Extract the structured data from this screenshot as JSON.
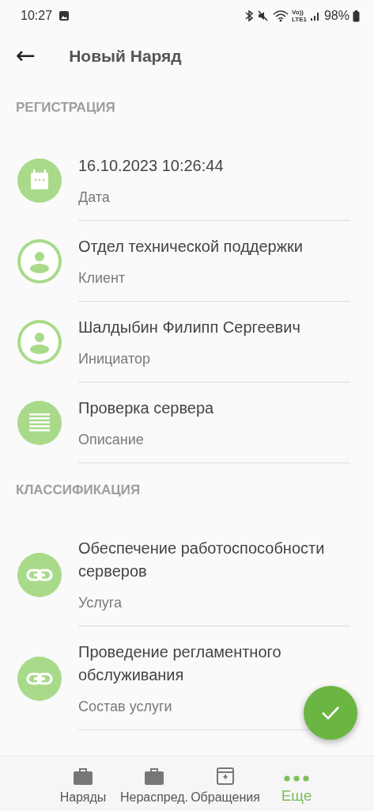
{
  "status_bar": {
    "time": "10:27",
    "volte": "Vo))",
    "lte": "LTE1",
    "battery": "98%"
  },
  "app_bar": {
    "back": "←",
    "title": "Новый Наряд"
  },
  "sections": [
    {
      "title": "РЕГИСТРАЦИЯ",
      "items": [
        {
          "kind": "calendar",
          "value": "16.10.2023 10:26:44",
          "label": "Дата"
        },
        {
          "kind": "person",
          "value": "Отдел технической поддержки",
          "label": "Клиент"
        },
        {
          "kind": "person",
          "value": "Шалдыбин Филипп Сергеевич",
          "label": "Инициатор"
        },
        {
          "kind": "text",
          "value": "Проверка сервера",
          "label": "Описание"
        }
      ]
    },
    {
      "title": "КЛАССИФИКАЦИЯ",
      "items": [
        {
          "kind": "link",
          "value": "Обеспечение работоспособности серверов",
          "label": "Услуга"
        },
        {
          "kind": "link",
          "value": "Проведение регламентного обслуживания",
          "label": "Состав услуги"
        }
      ]
    }
  ],
  "bottom_nav": [
    {
      "kind": "orders",
      "label": "Наряды",
      "selected": false
    },
    {
      "kind": "orders",
      "label": "Нераспред.",
      "selected": false
    },
    {
      "kind": "requests",
      "label": "Обращения",
      "selected": false
    },
    {
      "kind": "more",
      "label": "Еще",
      "selected": true
    }
  ]
}
